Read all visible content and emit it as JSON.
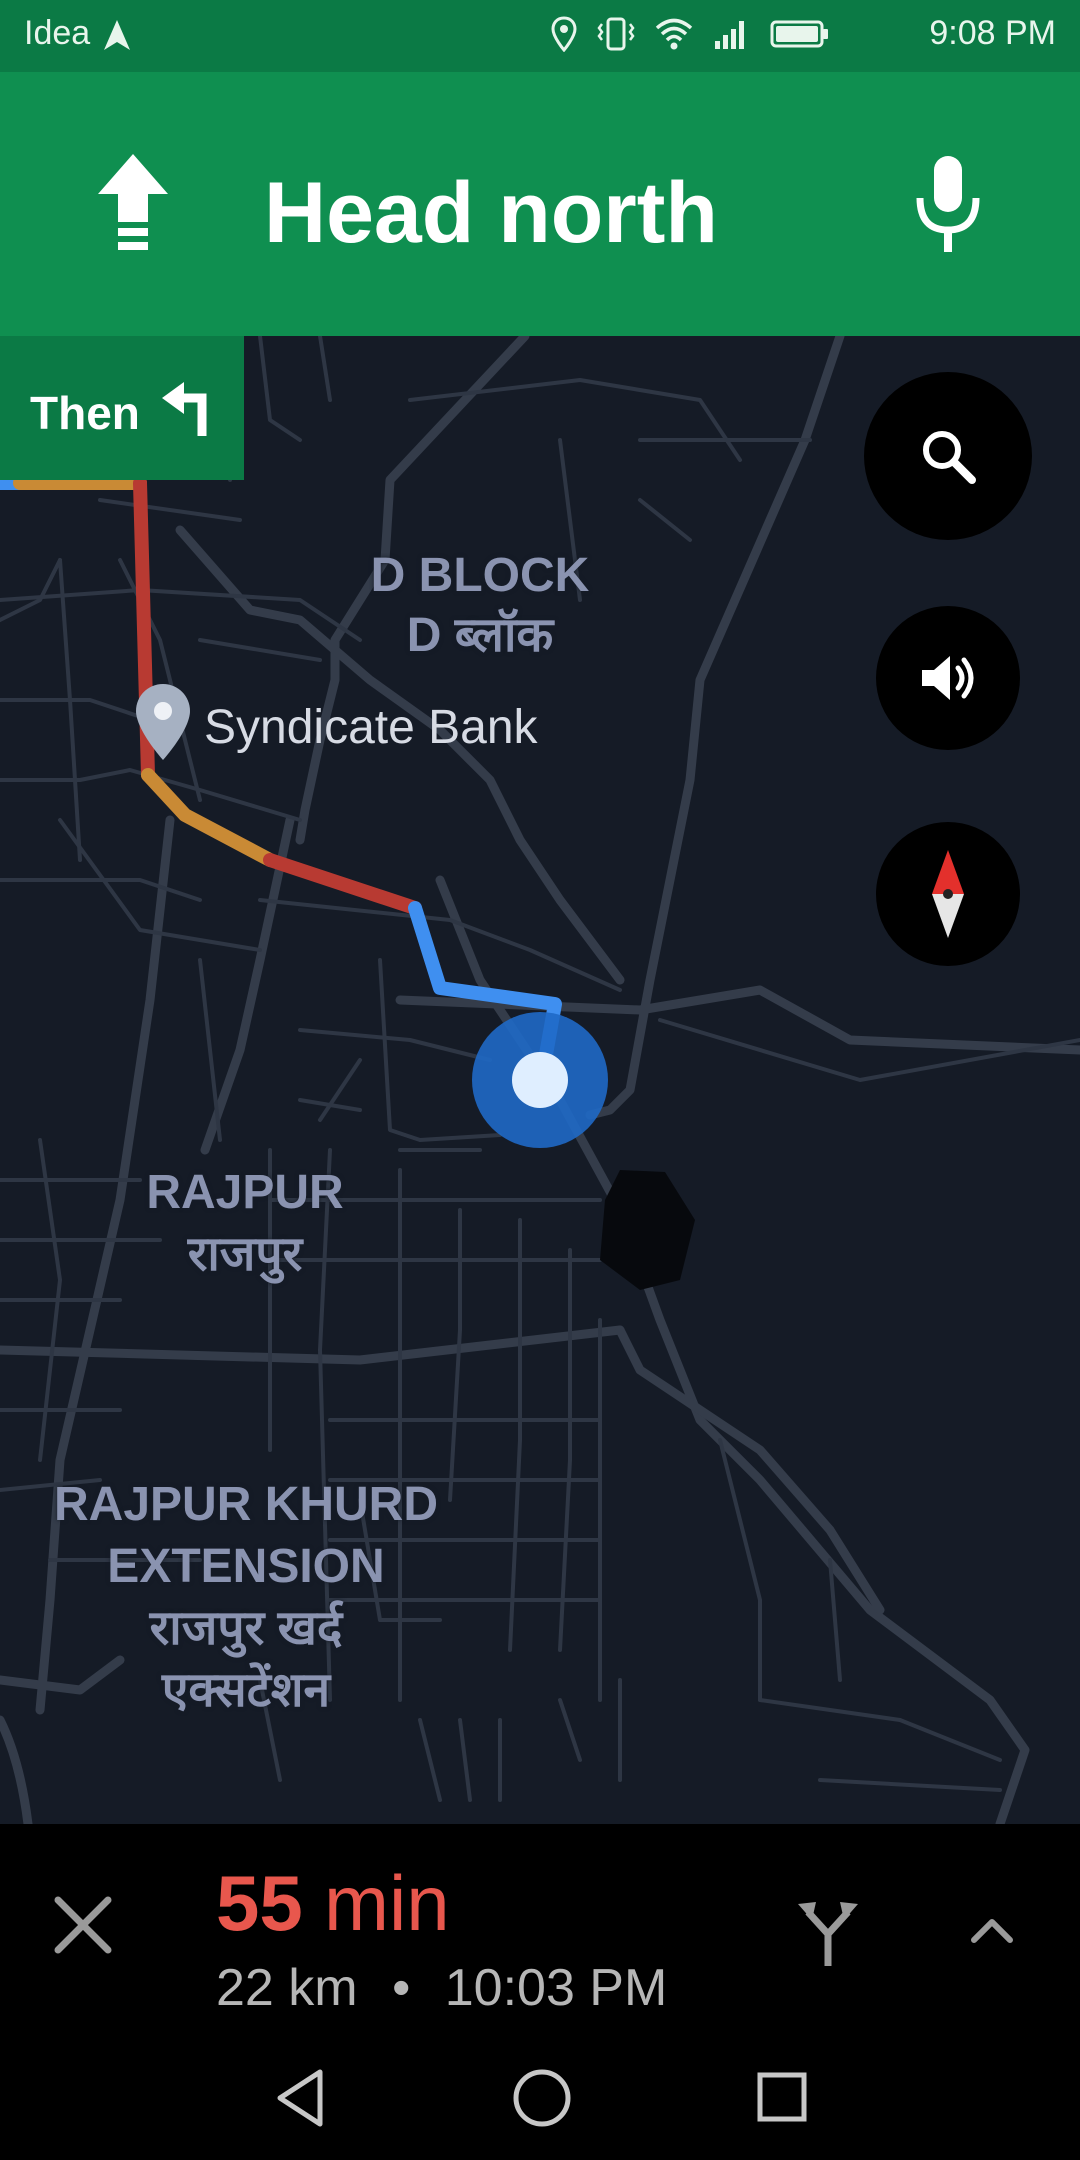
{
  "status_bar": {
    "carrier": "Idea",
    "time": "9:08 PM",
    "icons": [
      "navigation-arrow-icon",
      "location-icon",
      "vibrate-icon",
      "wifi-icon",
      "signal-icon",
      "battery-icon"
    ]
  },
  "navigation": {
    "instruction": "Head north",
    "maneuver_icon": "arrow-up-icon",
    "then_label": "Then",
    "then_icon": "turn-left-icon"
  },
  "map": {
    "areas": [
      {
        "line1": "D BLOCK",
        "line2": "D ब्लॉक"
      },
      {
        "line1": "RAJPUR",
        "line2": "राजपुर"
      },
      {
        "line1": "RAJPUR KHURD",
        "line2": "EXTENSION",
        "line3": "राजपुर खर्द",
        "line4": "एक्सटेंशन"
      }
    ],
    "poi": {
      "name": "Syndicate Bank",
      "icon": "map-pin-icon"
    },
    "buttons": [
      "search-icon",
      "volume-icon",
      "compass-icon"
    ]
  },
  "trip": {
    "duration_value": "55",
    "duration_unit": "min",
    "distance": "22 km",
    "separator": "•",
    "arrival": "10:03 PM"
  },
  "colors": {
    "header_green": "#0f8f50",
    "status_green": "#0b7a45",
    "route_blue": "#3f8ff0",
    "traffic_red": "#b83a32",
    "traffic_orange": "#c98a35",
    "eta_red": "#e8574d"
  }
}
